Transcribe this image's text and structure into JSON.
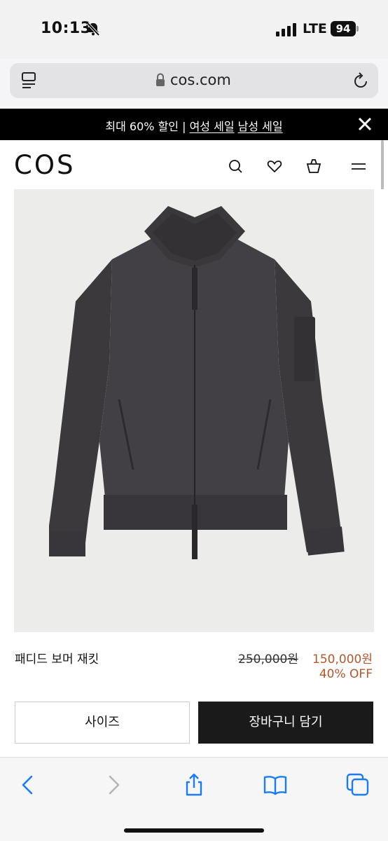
{
  "status": {
    "time": "10:13",
    "network": "LTE",
    "battery": "94"
  },
  "url_bar": {
    "domain": "cos.com"
  },
  "promo": {
    "text": "최대 60% 할인 | ",
    "link_women": "여성 세일",
    "link_men": "남성 세일"
  },
  "header": {
    "logo": "COS"
  },
  "product": {
    "name": "패디드 보머 재킷",
    "original_price": "250,000원",
    "sale_price": "150,000원",
    "discount": "40% OFF",
    "image_alt": "jacket-image"
  },
  "actions": {
    "size_label": "사이즈",
    "cart_label": "장바구니 담기"
  },
  "colors": {
    "accent": "#b5552a",
    "banner": "#000000",
    "cart_button": "#1a1a1a"
  },
  "icons": {
    "header": [
      "search-icon",
      "heart-icon",
      "bag-icon",
      "menu-icon"
    ],
    "toolbar": [
      "back-icon",
      "forward-icon",
      "share-icon",
      "bookmarks-icon",
      "tabs-icon"
    ]
  }
}
